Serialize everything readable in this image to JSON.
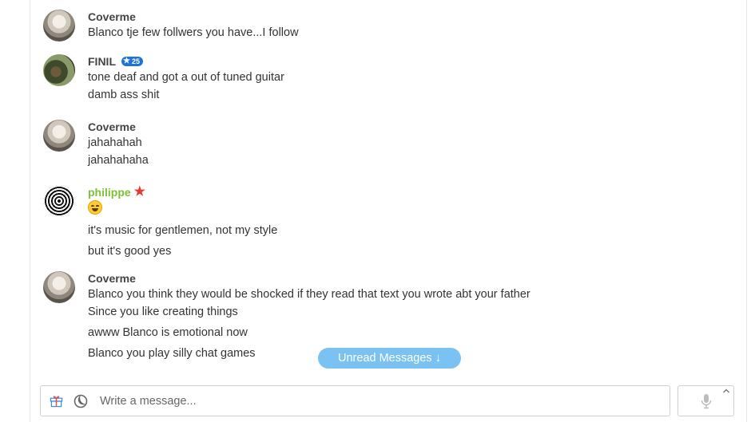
{
  "messages": [
    {
      "user": "Coverme",
      "avatar": "coverme",
      "lines": [
        "Blanco tje few follwers you have...I follow"
      ]
    },
    {
      "user": "FINIL",
      "avatar": "finil",
      "badge": "25",
      "lines": [
        "tone deaf and got a out of tuned guitar",
        "damb  ass  shit"
      ]
    },
    {
      "user": "Coverme",
      "avatar": "coverme",
      "lines": [
        "jahahahah",
        "jahahahaha"
      ]
    },
    {
      "user": "philippe",
      "avatar": "philippe",
      "emoji": "grinning-face",
      "lines": [
        "it's music for gentlemen, not my style",
        "but it's good yes"
      ]
    },
    {
      "user": "Coverme",
      "avatar": "coverme",
      "lines": [
        "Blanco you think they  would be shocked if they  read that text you wrote abt your father",
        "Since you  like creating things",
        "awww Blanco is emotional now",
        "Blanco you play silly chat games"
      ]
    }
  ],
  "unread": {
    "label": "Unread Messages ↓"
  },
  "composer": {
    "placeholder": "Write a message..."
  },
  "colors": {
    "accent": "#79c2f2",
    "badge": "#1e73d8",
    "philippe_name": "#7cc034",
    "star": "#e53935"
  },
  "icons": [
    "gift-icon",
    "moon-icon",
    "microphone-icon",
    "chevron-up-icon",
    "star-icon"
  ]
}
